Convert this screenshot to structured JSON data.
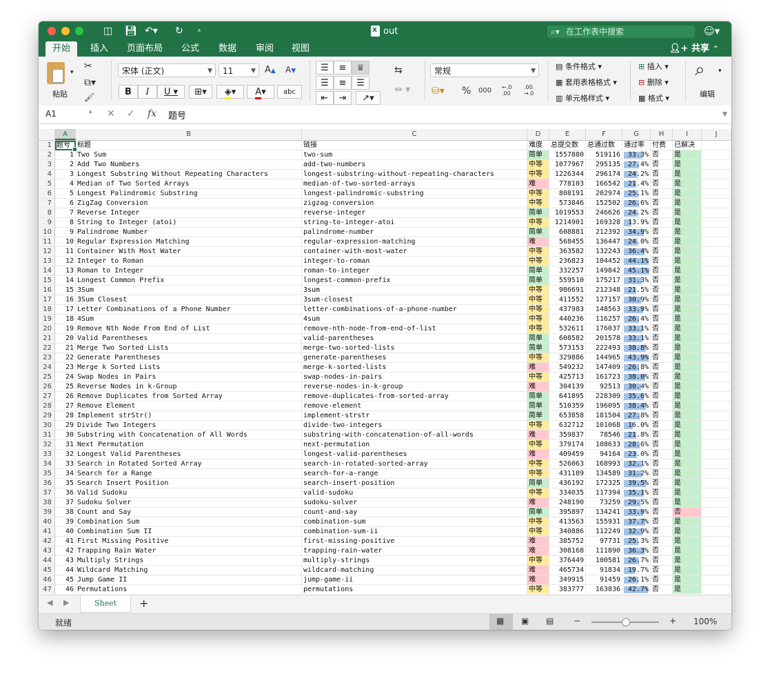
{
  "window": {
    "title": "out"
  },
  "search": {
    "placeholder": "在工作表中搜索"
  },
  "tabs": [
    "开始",
    "插入",
    "页面布局",
    "公式",
    "数据",
    "审阅",
    "视图"
  ],
  "share_label": "共享",
  "ribbon": {
    "paste_label": "粘贴",
    "font_name": "宋体 (正文)",
    "font_size": "11",
    "number_format": "常规",
    "cond_format": "条件格式",
    "table_format": "套用表格格式",
    "cell_styles": "单元格样式",
    "insert": "插入",
    "delete": "删除",
    "format": "格式",
    "edit": "编辑",
    "bold": "B",
    "italic": "I",
    "underline": "U",
    "percent": "%",
    "thousands": "000",
    "dec_inc": "←.0\n.00",
    "dec_dec": ".00\n→.0"
  },
  "formula_bar": {
    "cell_ref": "A1",
    "fx": "fx",
    "value": "题号"
  },
  "columns": [
    "A",
    "B",
    "C",
    "D",
    "E",
    "F",
    "G",
    "H",
    "I",
    "J"
  ],
  "header_row": {
    "rn": "1",
    "A": "题号",
    "B": "标题",
    "C": "链接",
    "D": "难度",
    "E": "总提交数",
    "F": "总通过数",
    "G": "通过率",
    "H": "付费",
    "I": "已解决"
  },
  "rows": [
    {
      "rn": "2",
      "id": "1",
      "title": "Two Sum",
      "slug": "two-sum",
      "diff": "简单",
      "sub": "1557880",
      "acc": "519116",
      "rate": "33.3%",
      "rate_v": 33.3,
      "paid": "否",
      "solved": "是"
    },
    {
      "rn": "3",
      "id": "2",
      "title": "Add Two Numbers",
      "slug": "add-two-numbers",
      "diff": "中等",
      "sub": "1077967",
      "acc": "295135",
      "rate": "27.4%",
      "rate_v": 27.4,
      "paid": "否",
      "solved": "是"
    },
    {
      "rn": "4",
      "id": "3",
      "title": "Longest Substring Without Repeating Characters",
      "slug": "longest-substring-without-repeating-characters",
      "diff": "中等",
      "sub": "1226344",
      "acc": "296174",
      "rate": "24.2%",
      "rate_v": 24.2,
      "paid": "否",
      "solved": "是"
    },
    {
      "rn": "5",
      "id": "4",
      "title": "Median of Two Sorted Arrays",
      "slug": "median-of-two-sorted-arrays",
      "diff": "难",
      "sub": "778103",
      "acc": "166542",
      "rate": "21.4%",
      "rate_v": 21.4,
      "paid": "否",
      "solved": "是"
    },
    {
      "rn": "6",
      "id": "5",
      "title": "Longest Palindromic Substring",
      "slug": "longest-palindromic-substring",
      "diff": "中等",
      "sub": "808191",
      "acc": "202974",
      "rate": "25.1%",
      "rate_v": 25.1,
      "paid": "否",
      "solved": "是"
    },
    {
      "rn": "7",
      "id": "6",
      "title": "ZigZag Conversion",
      "slug": "zigzag-conversion",
      "diff": "中等",
      "sub": "573846",
      "acc": "152502",
      "rate": "26.6%",
      "rate_v": 26.6,
      "paid": "否",
      "solved": "是"
    },
    {
      "rn": "8",
      "id": "7",
      "title": "Reverse Integer",
      "slug": "reverse-integer",
      "diff": "简单",
      "sub": "1019553",
      "acc": "246626",
      "rate": "24.2%",
      "rate_v": 24.2,
      "paid": "否",
      "solved": "是"
    },
    {
      "rn": "9",
      "id": "8",
      "title": "String to Integer (atoi)",
      "slug": "string-to-integer-atoi",
      "diff": "中等",
      "sub": "1214901",
      "acc": "169328",
      "rate": "13.9%",
      "rate_v": 13.9,
      "paid": "否",
      "solved": "是"
    },
    {
      "rn": "10",
      "id": "9",
      "title": "Palindrome Number",
      "slug": "palindrome-number",
      "diff": "简单",
      "sub": "608881",
      "acc": "212392",
      "rate": "34.9%",
      "rate_v": 34.9,
      "paid": "否",
      "solved": "是"
    },
    {
      "rn": "11",
      "id": "10",
      "title": "Regular Expression Matching",
      "slug": "regular-expression-matching",
      "diff": "难",
      "sub": "568455",
      "acc": "136447",
      "rate": "24.0%",
      "rate_v": 24.0,
      "paid": "否",
      "solved": "是"
    },
    {
      "rn": "12",
      "id": "11",
      "title": "Container With Most Water",
      "slug": "container-with-most-water",
      "diff": "中等",
      "sub": "363582",
      "acc": "132243",
      "rate": "36.4%",
      "rate_v": 36.4,
      "paid": "否",
      "solved": "是"
    },
    {
      "rn": "13",
      "id": "12",
      "title": "Integer to Roman",
      "slug": "integer-to-roman",
      "diff": "中等",
      "sub": "236823",
      "acc": "104452",
      "rate": "44.1%",
      "rate_v": 44.1,
      "paid": "否",
      "solved": "是"
    },
    {
      "rn": "14",
      "id": "13",
      "title": "Roman to Integer",
      "slug": "roman-to-integer",
      "diff": "简单",
      "sub": "332257",
      "acc": "149842",
      "rate": "45.1%",
      "rate_v": 45.1,
      "paid": "否",
      "solved": "是"
    },
    {
      "rn": "15",
      "id": "14",
      "title": "Longest Common Prefix",
      "slug": "longest-common-prefix",
      "diff": "简单",
      "sub": "559510",
      "acc": "175217",
      "rate": "31.3%",
      "rate_v": 31.3,
      "paid": "否",
      "solved": "是"
    },
    {
      "rn": "16",
      "id": "15",
      "title": "3Sum",
      "slug": "3sum",
      "diff": "中等",
      "sub": "986691",
      "acc": "212348",
      "rate": "21.5%",
      "rate_v": 21.5,
      "paid": "否",
      "solved": "是"
    },
    {
      "rn": "17",
      "id": "16",
      "title": "3Sum Closest",
      "slug": "3sum-closest",
      "diff": "中等",
      "sub": "411552",
      "acc": "127157",
      "rate": "30.9%",
      "rate_v": 30.9,
      "paid": "否",
      "solved": "是"
    },
    {
      "rn": "18",
      "id": "17",
      "title": "Letter Combinations of a Phone Number",
      "slug": "letter-combinations-of-a-phone-number",
      "diff": "中等",
      "sub": "437983",
      "acc": "148563",
      "rate": "33.9%",
      "rate_v": 33.9,
      "paid": "否",
      "solved": "是"
    },
    {
      "rn": "19",
      "id": "18",
      "title": "4Sum",
      "slug": "4sum",
      "diff": "中等",
      "sub": "440236",
      "acc": "116257",
      "rate": "26.4%",
      "rate_v": 26.4,
      "paid": "否",
      "solved": "是"
    },
    {
      "rn": "20",
      "id": "19",
      "title": "Remove Nth Node From End of List",
      "slug": "remove-nth-node-from-end-of-list",
      "diff": "中等",
      "sub": "532611",
      "acc": "176037",
      "rate": "33.1%",
      "rate_v": 33.1,
      "paid": "否",
      "solved": "是"
    },
    {
      "rn": "21",
      "id": "20",
      "title": "Valid Parentheses",
      "slug": "valid-parentheses",
      "diff": "简单",
      "sub": "608582",
      "acc": "201578",
      "rate": "33.1%",
      "rate_v": 33.1,
      "paid": "否",
      "solved": "是"
    },
    {
      "rn": "22",
      "id": "21",
      "title": "Merge Two Sorted Lists",
      "slug": "merge-two-sorted-lists",
      "diff": "简单",
      "sub": "573153",
      "acc": "222493",
      "rate": "38.8%",
      "rate_v": 38.8,
      "paid": "否",
      "solved": "是"
    },
    {
      "rn": "23",
      "id": "22",
      "title": "Generate Parentheses",
      "slug": "generate-parentheses",
      "diff": "中等",
      "sub": "329886",
      "acc": "144965",
      "rate": "43.9%",
      "rate_v": 43.9,
      "paid": "否",
      "solved": "是"
    },
    {
      "rn": "24",
      "id": "23",
      "title": "Merge k Sorted Lists",
      "slug": "merge-k-sorted-lists",
      "diff": "难",
      "sub": "549232",
      "acc": "147409",
      "rate": "26.8%",
      "rate_v": 26.8,
      "paid": "否",
      "solved": "是"
    },
    {
      "rn": "25",
      "id": "24",
      "title": "Swap Nodes in Pairs",
      "slug": "swap-nodes-in-pairs",
      "diff": "中等",
      "sub": "425713",
      "acc": "161723",
      "rate": "38.0%",
      "rate_v": 38.0,
      "paid": "否",
      "solved": "是"
    },
    {
      "rn": "26",
      "id": "25",
      "title": "Reverse Nodes in k-Group",
      "slug": "reverse-nodes-in-k-group",
      "diff": "难",
      "sub": "304139",
      "acc": "92513",
      "rate": "30.4%",
      "rate_v": 30.4,
      "paid": "否",
      "solved": "是"
    },
    {
      "rn": "27",
      "id": "26",
      "title": "Remove Duplicates from Sorted Array",
      "slug": "remove-duplicates-from-sorted-array",
      "diff": "简单",
      "sub": "641895",
      "acc": "228309",
      "rate": "35.6%",
      "rate_v": 35.6,
      "paid": "否",
      "solved": "是"
    },
    {
      "rn": "28",
      "id": "27",
      "title": "Remove Element",
      "slug": "remove-element",
      "diff": "简单",
      "sub": "510359",
      "acc": "196095",
      "rate": "38.4%",
      "rate_v": 38.4,
      "paid": "否",
      "solved": "是"
    },
    {
      "rn": "29",
      "id": "28",
      "title": "Implement strStr()",
      "slug": "implement-strstr",
      "diff": "简单",
      "sub": "653858",
      "acc": "181504",
      "rate": "27.8%",
      "rate_v": 27.8,
      "paid": "否",
      "solved": "是"
    },
    {
      "rn": "30",
      "id": "29",
      "title": "Divide Two Integers",
      "slug": "divide-two-integers",
      "diff": "中等",
      "sub": "632712",
      "acc": "101068",
      "rate": "16.0%",
      "rate_v": 16.0,
      "paid": "否",
      "solved": "是"
    },
    {
      "rn": "31",
      "id": "30",
      "title": "Substring with Concatenation of All Words",
      "slug": "substring-with-concatenation-of-all-words",
      "diff": "难",
      "sub": "359837",
      "acc": "78546",
      "rate": "21.8%",
      "rate_v": 21.8,
      "paid": "否",
      "solved": "是"
    },
    {
      "rn": "32",
      "id": "31",
      "title": "Next Permutation",
      "slug": "next-permutation",
      "diff": "中等",
      "sub": "379174",
      "acc": "108633",
      "rate": "28.6%",
      "rate_v": 28.6,
      "paid": "否",
      "solved": "是"
    },
    {
      "rn": "33",
      "id": "32",
      "title": "Longest Valid Parentheses",
      "slug": "longest-valid-parentheses",
      "diff": "难",
      "sub": "409459",
      "acc": "94164",
      "rate": "23.0%",
      "rate_v": 23.0,
      "paid": "否",
      "solved": "是"
    },
    {
      "rn": "34",
      "id": "33",
      "title": "Search in Rotated Sorted Array",
      "slug": "search-in-rotated-sorted-array",
      "diff": "中等",
      "sub": "526063",
      "acc": "168993",
      "rate": "32.1%",
      "rate_v": 32.1,
      "paid": "否",
      "solved": "是"
    },
    {
      "rn": "35",
      "id": "34",
      "title": "Search for a Range",
      "slug": "search-for-a-range",
      "diff": "中等",
      "sub": "431189",
      "acc": "134589",
      "rate": "31.2%",
      "rate_v": 31.2,
      "paid": "否",
      "solved": "是"
    },
    {
      "rn": "36",
      "id": "35",
      "title": "Search Insert Position",
      "slug": "search-insert-position",
      "diff": "简单",
      "sub": "436192",
      "acc": "172325",
      "rate": "39.5%",
      "rate_v": 39.5,
      "paid": "否",
      "solved": "是"
    },
    {
      "rn": "37",
      "id": "36",
      "title": "Valid Sudoku",
      "slug": "valid-sudoku",
      "diff": "中等",
      "sub": "334035",
      "acc": "117394",
      "rate": "35.1%",
      "rate_v": 35.1,
      "paid": "否",
      "solved": "是"
    },
    {
      "rn": "38",
      "id": "37",
      "title": "Sudoku Solver",
      "slug": "sudoku-solver",
      "diff": "难",
      "sub": "248190",
      "acc": "73259",
      "rate": "29.5%",
      "rate_v": 29.5,
      "paid": "否",
      "solved": "是"
    },
    {
      "rn": "39",
      "id": "38",
      "title": "Count and Say",
      "slug": "count-and-say",
      "diff": "简单",
      "sub": "395897",
      "acc": "134241",
      "rate": "33.9%",
      "rate_v": 33.9,
      "paid": "否",
      "solved": "否"
    },
    {
      "rn": "40",
      "id": "39",
      "title": "Combination Sum",
      "slug": "combination-sum",
      "diff": "中等",
      "sub": "413563",
      "acc": "155931",
      "rate": "37.7%",
      "rate_v": 37.7,
      "paid": "否",
      "solved": "是"
    },
    {
      "rn": "41",
      "id": "40",
      "title": "Combination Sum II",
      "slug": "combination-sum-ii",
      "diff": "中等",
      "sub": "340886",
      "acc": "112249",
      "rate": "32.9%",
      "rate_v": 32.9,
      "paid": "否",
      "solved": "是"
    },
    {
      "rn": "42",
      "id": "41",
      "title": "First Missing Positive",
      "slug": "first-missing-positive",
      "diff": "难",
      "sub": "385752",
      "acc": "97731",
      "rate": "25.3%",
      "rate_v": 25.3,
      "paid": "否",
      "solved": "是"
    },
    {
      "rn": "43",
      "id": "42",
      "title": "Trapping Rain Water",
      "slug": "trapping-rain-water",
      "diff": "难",
      "sub": "308168",
      "acc": "111890",
      "rate": "36.3%",
      "rate_v": 36.3,
      "paid": "否",
      "solved": "是"
    },
    {
      "rn": "44",
      "id": "43",
      "title": "Multiply Strings",
      "slug": "multiply-strings",
      "diff": "中等",
      "sub": "376449",
      "acc": "100581",
      "rate": "26.7%",
      "rate_v": 26.7,
      "paid": "否",
      "solved": "是"
    },
    {
      "rn": "45",
      "id": "44",
      "title": "Wildcard Matching",
      "slug": "wildcard-matching",
      "diff": "难",
      "sub": "465734",
      "acc": "91834",
      "rate": "19.7%",
      "rate_v": 19.7,
      "paid": "否",
      "solved": "是"
    },
    {
      "rn": "46",
      "id": "45",
      "title": "Jump Game II",
      "slug": "jump-game-ii",
      "diff": "难",
      "sub": "349915",
      "acc": "91459",
      "rate": "26.1%",
      "rate_v": 26.1,
      "paid": "否",
      "solved": "是"
    },
    {
      "rn": "47",
      "id": "46",
      "title": "Permutations",
      "slug": "permutations",
      "diff": "中等",
      "sub": "383777",
      "acc": "163836",
      "rate": "42.7%",
      "rate_v": 42.7,
      "paid": "否",
      "solved": "是"
    }
  ],
  "difficulty_colors": {
    "简单": "#c6efce",
    "中等": "#ffeb9c",
    "难": "#ffc7ce"
  },
  "solved_colors": {
    "是": "#c6efce",
    "否": "#ffc7ce"
  },
  "sheet_tab": "Sheet",
  "status": {
    "ready": "就绪",
    "zoom": "100%"
  }
}
